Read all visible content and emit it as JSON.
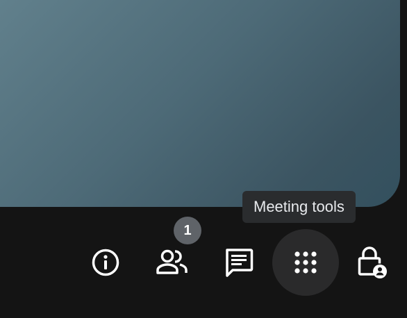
{
  "tooltip": {
    "text": "Meeting tools"
  },
  "controls": {
    "info": {
      "icon": "info-icon"
    },
    "people": {
      "icon": "people-icon",
      "badge_count": "1"
    },
    "chat": {
      "icon": "chat-icon"
    },
    "meeting_tools": {
      "icon": "apps-grid-icon",
      "active": true
    },
    "host_controls": {
      "icon": "lock-person-icon"
    }
  },
  "colors": {
    "background": "#141414",
    "tile_gradient_start": "#61808c",
    "tile_gradient_end": "#33505e",
    "tooltip_bg": "#2a2c2e",
    "active_button_bg": "#2a2a2b",
    "badge_bg": "#5f6368",
    "icon": "#ffffff"
  }
}
